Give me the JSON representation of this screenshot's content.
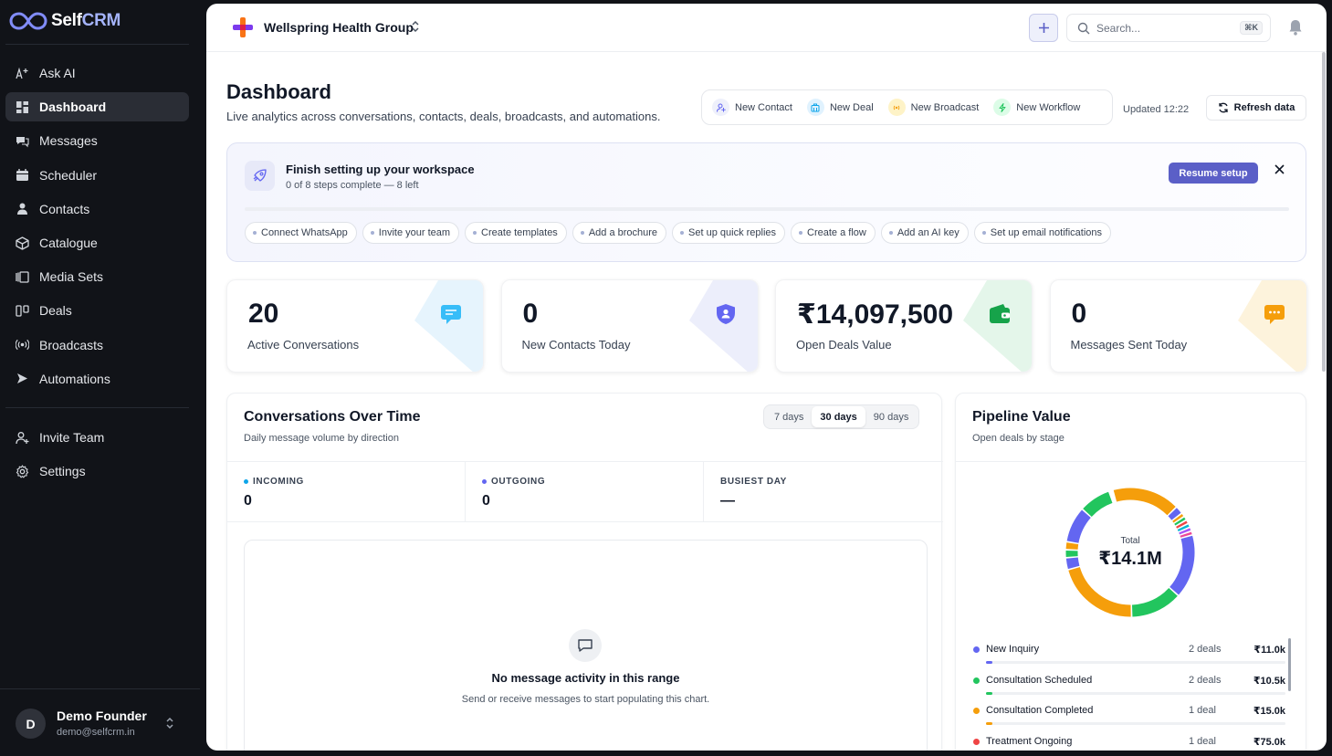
{
  "brand": {
    "self": "Self",
    "crm": "CRM"
  },
  "sidebar": {
    "items": [
      {
        "label": "Ask AI",
        "icon": "sparkle-text-icon"
      },
      {
        "label": "Dashboard",
        "icon": "dashboard-icon",
        "active": true
      },
      {
        "label": "Messages",
        "icon": "messages-icon"
      },
      {
        "label": "Scheduler",
        "icon": "calendar-icon"
      },
      {
        "label": "Contacts",
        "icon": "person-icon"
      },
      {
        "label": "Catalogue",
        "icon": "box-icon"
      },
      {
        "label": "Media Sets",
        "icon": "media-icon"
      },
      {
        "label": "Deals",
        "icon": "deals-icon"
      },
      {
        "label": "Broadcasts",
        "icon": "broadcast-icon"
      },
      {
        "label": "Automations",
        "icon": "automation-icon"
      }
    ],
    "bottom_items": [
      {
        "label": "Invite Team",
        "icon": "invite-icon"
      },
      {
        "label": "Settings",
        "icon": "settings-icon"
      }
    ],
    "user": {
      "initial": "D",
      "name": "Demo Founder",
      "email": "demo@selfcrm.in"
    }
  },
  "topbar": {
    "org_name": "Wellspring Health Group",
    "search_placeholder": "Search...",
    "search_shortcut": "⌘K"
  },
  "header": {
    "title": "Dashboard",
    "subtitle": "Live analytics across conversations, contacts, deals, broadcasts, and automations.",
    "quick_actions": [
      {
        "label": "New Contact",
        "color": "#6366f1",
        "bg": "#eef0fb"
      },
      {
        "label": "New Deal",
        "color": "#0ea5e9",
        "bg": "#e0f2fe"
      },
      {
        "label": "New Broadcast",
        "color": "#f59e0b",
        "bg": "#fef3c7"
      },
      {
        "label": "New Workflow",
        "color": "#22c55e",
        "bg": "#dcfce7"
      }
    ],
    "updated": "Updated 12:22",
    "refresh_label": "Refresh data"
  },
  "setup": {
    "title": "Finish setting up your workspace",
    "subtitle": "0 of 8 steps complete — 8 left",
    "resume_label": "Resume setup",
    "progress": 0,
    "steps": [
      "Connect WhatsApp",
      "Invite your team",
      "Create templates",
      "Add a brochure",
      "Set up quick replies",
      "Create a flow",
      "Add an AI key",
      "Set up email notifications"
    ]
  },
  "stats": [
    {
      "value": "20",
      "label": "Active Conversations",
      "accent": "#38bdf8",
      "tint": "#e6f4fd"
    },
    {
      "value": "0",
      "label": "New Contacts Today",
      "accent": "#6366f1",
      "tint": "#eceefb"
    },
    {
      "value": "₹14,097,500",
      "label": "Open Deals Value",
      "accent": "#16a34a",
      "tint": "#e4f6ea"
    },
    {
      "value": "0",
      "label": "Messages Sent Today",
      "accent": "#f59e0b",
      "tint": "#fdf3dc"
    }
  ],
  "conversations": {
    "title": "Conversations Over Time",
    "subtitle": "Daily message volume by direction",
    "ranges": [
      "7 days",
      "30 days",
      "90 days"
    ],
    "active_range": "30 days",
    "metrics": [
      {
        "key": "INCOMING",
        "value": "0",
        "dot": "#0ea5e9"
      },
      {
        "key": "OUTGOING",
        "value": "0",
        "dot": "#6366f1"
      },
      {
        "key": "BUSIEST DAY",
        "value": "—",
        "dot": ""
      }
    ],
    "empty_title": "No message activity in this range",
    "empty_sub": "Send or receive messages to start populating this chart."
  },
  "pipeline": {
    "title": "Pipeline Value",
    "subtitle": "Open deals by stage",
    "total_label": "Total",
    "total": "₹14.1M",
    "stages": [
      {
        "name": "New Inquiry",
        "count": "2 deals",
        "value": "₹11.0k",
        "color": "#6366f1",
        "share": 0.02
      },
      {
        "name": "Consultation Scheduled",
        "count": "2 deals",
        "value": "₹10.5k",
        "color": "#22c55e",
        "share": 0.02
      },
      {
        "name": "Consultation Completed",
        "count": "1 deal",
        "value": "₹15.0k",
        "color": "#f59e0b",
        "share": 0.02
      },
      {
        "name": "Treatment Ongoing",
        "count": "1 deal",
        "value": "₹75.0k",
        "color": "#ef4444",
        "share": 0.05
      }
    ]
  }
}
